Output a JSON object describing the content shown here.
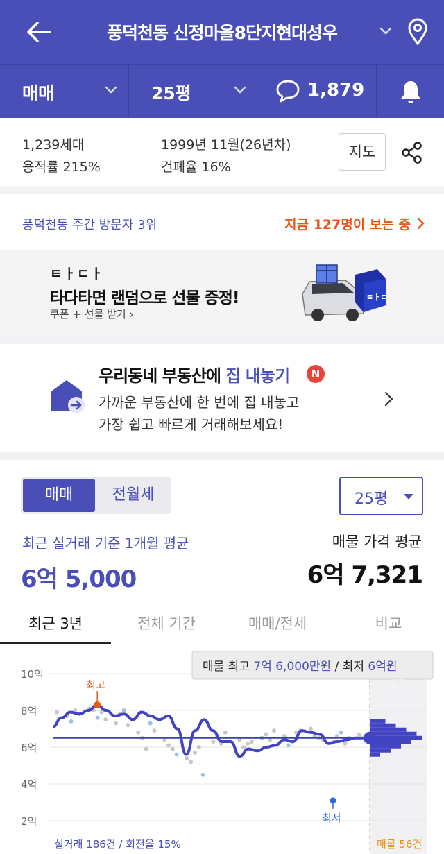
{
  "header": {
    "title": "풍덕천동 신정마을8단지현대성우"
  },
  "filters": {
    "trade_type": "매매",
    "area": "25평",
    "comment_count": "1,879"
  },
  "info": {
    "households": "1,239세대",
    "floor_area_ratio": "용적률 215%",
    "built": "1999년 11월(26년차)",
    "coverage_ratio": "건폐율 16%",
    "map_button": "지도"
  },
  "visitors": {
    "rank": "풍덕천동 주간 방문자 3위",
    "viewing_now": "지금 127명이 보는 중"
  },
  "ad": {
    "logo": "ㅌㅏㄷㅏ",
    "title": "타다타면 랜덤으로 선물 증정!",
    "subtitle": "쿠폰 + 선물 받기 ›",
    "car_badge": "ㅌㅏㄷㅏ"
  },
  "promo": {
    "title_a": "우리동네 부동산에 ",
    "title_b": "집 내놓기",
    "badge": "N",
    "desc1": "가까운 부동산에 한 번에 집 내놓고",
    "desc2": "가장 쉽고 빠르게 거래해보세요!"
  },
  "price": {
    "seg_sale": "매매",
    "seg_rent": "전월세",
    "area_select": "25평",
    "avg_label": "최근 실거래 기준 1개월 평균",
    "avg_value": "6억 5,000",
    "ask_label": "매물 가격 평균",
    "ask_value": "6억 7,321",
    "tabs": [
      "최근 3년",
      "전체 기간",
      "매매/전세",
      "비교"
    ]
  },
  "colors": {
    "brand": "#4a4fb8",
    "accent_orange": "#e8581b",
    "high_marker": "#e8581b",
    "low_marker": "#2a6fd6"
  },
  "chart_data": {
    "type": "line",
    "ylabel_ticks": [
      "10억",
      "8억",
      "6억",
      "4억",
      "2억"
    ],
    "ylim": [
      2,
      10
    ],
    "unit": "억",
    "grid": true,
    "tooltip": {
      "prefix": "매물 최고 ",
      "high": "7억 6,000만원",
      "sep": " / 최저 ",
      "low": "6억원"
    },
    "high_label": "최고",
    "low_label": "최저",
    "footer_left": "실거래 186건 / 회전율 15%",
    "footer_right": "매물 56건",
    "average_line": 6.5,
    "series": [
      {
        "values": [
          7.1,
          7.6,
          7.9,
          7.8,
          8.0,
          8.3,
          8.0,
          7.7,
          7.8,
          7.5,
          7.9,
          7.7,
          7.5,
          7.7,
          7.0,
          5.6,
          6.9,
          7.5,
          6.9,
          6.3,
          6.3,
          5.5,
          5.9,
          5.8,
          6.0,
          6.1,
          6.4,
          6.3,
          6.9,
          6.8,
          6.7,
          6.2,
          6.3,
          6.4,
          6.5,
          6.5
        ]
      }
    ],
    "scatter": [
      7.9,
      7.7,
      7.4,
      8.0,
      7.8,
      8.1,
      8.0,
      7.6,
      7.9,
      7.5,
      7.3,
      7.8,
      8.0,
      7.2,
      6.8,
      6.5,
      5.9,
      7.3,
      6.9,
      6.4,
      6.1,
      5.9,
      5.6,
      5.4,
      5.2,
      5.7,
      6.0,
      4.5,
      6.3,
      6.6,
      6.2,
      6.8,
      5.8,
      6.4,
      6.0,
      6.2,
      6.3,
      6.5,
      6.7,
      6.4,
      6.9,
      6.6,
      6.1,
      6.3,
      6.8,
      6.9,
      7.0,
      6.6,
      6.5,
      6.4,
      6.3,
      6.6,
      6.8,
      6.2,
      6.5,
      6.7
    ],
    "low_point": 3.1,
    "listing_histogram": [
      0.3,
      0.5,
      0.7,
      0.9,
      1.0,
      0.8,
      0.6,
      0.4,
      0.2
    ]
  }
}
